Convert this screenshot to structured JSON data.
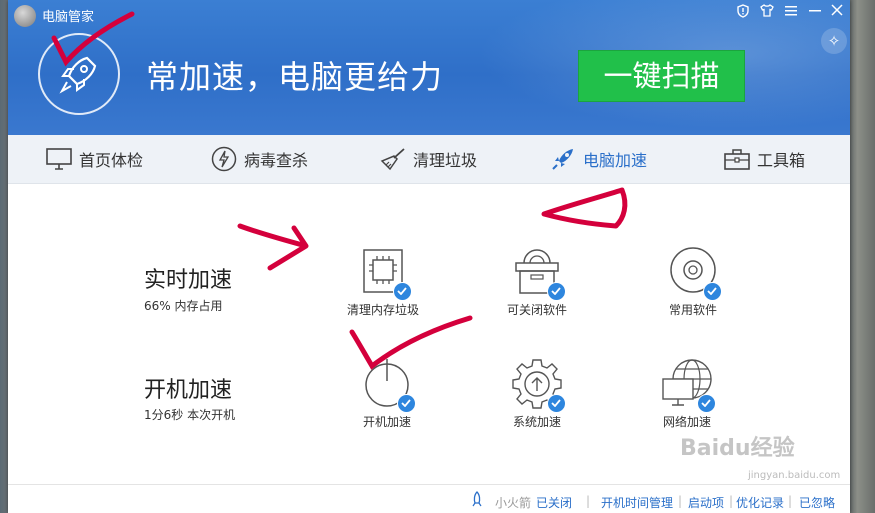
{
  "window": {
    "title": "电脑管家"
  },
  "header": {
    "slogan": "常加速，电脑更给力",
    "scan_button": "一键扫描"
  },
  "nav": [
    {
      "label": "首页体检",
      "icon": "monitor-icon"
    },
    {
      "label": "病毒查杀",
      "icon": "lightning-icon"
    },
    {
      "label": "清理垃圾",
      "icon": "broom-icon"
    },
    {
      "label": "电脑加速",
      "icon": "rocket-icon",
      "active": true
    },
    {
      "label": "工具箱",
      "icon": "toolbox-icon"
    }
  ],
  "realtime": {
    "title": "实时加速",
    "status": "66% 内存占用",
    "tiles": [
      {
        "label": "清理内存垃圾",
        "icon": "memory-chip-icon"
      },
      {
        "label": "可关闭软件",
        "icon": "software-box-icon"
      },
      {
        "label": "常用软件",
        "icon": "disc-icon"
      }
    ]
  },
  "boot": {
    "title": "开机加速",
    "status": "1分6秒 本次开机",
    "tiles": [
      {
        "label": "开机加速",
        "icon": "power-icon"
      },
      {
        "label": "系统加速",
        "icon": "gear-icon"
      },
      {
        "label": "网络加速",
        "icon": "globe-monitor-icon"
      }
    ]
  },
  "footer": {
    "rocket_label": "小火箭",
    "rocket_status": "已关闭",
    "boot_time_manage": "开机时间管理",
    "startup_items": "启动项",
    "optimize_log": "优化记录",
    "ignored": "已忽略"
  },
  "watermark": {
    "text": "Baidu经验",
    "url": "jingyan.baidu.com"
  },
  "colors": {
    "header": "#3277cc",
    "scan_button": "#21c04a",
    "accent": "#2a6fc9",
    "annotation": "#d4003c"
  }
}
